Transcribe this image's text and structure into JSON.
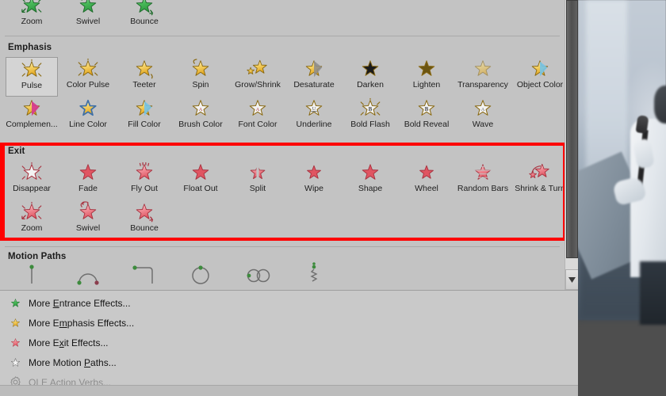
{
  "gallery": {
    "background_color": "#c3c3c3",
    "sections": [
      {
        "title": "",
        "kind": "entrance-partial",
        "color": "#3aa64a",
        "rows": [
          [
            {
              "label": "Zoom",
              "icon": "star-zoom-icon"
            },
            {
              "label": "Swivel",
              "icon": "star-swivel-icon"
            },
            {
              "label": "Bounce",
              "icon": "star-bounce-icon"
            }
          ]
        ]
      },
      {
        "title": "Emphasis",
        "kind": "emphasis",
        "color": "#e8b21f",
        "rows": [
          [
            {
              "label": "Pulse",
              "icon": "star-pulse-icon",
              "selected": true
            },
            {
              "label": "Color Pulse",
              "icon": "star-color-pulse-icon"
            },
            {
              "label": "Teeter",
              "icon": "star-teeter-icon"
            },
            {
              "label": "Spin",
              "icon": "star-spin-icon"
            },
            {
              "label": "Grow/Shrink",
              "icon": "star-grow-shrink-icon"
            },
            {
              "label": "Desaturate",
              "icon": "star-desaturate-icon"
            },
            {
              "label": "Darken",
              "icon": "star-darken-icon"
            },
            {
              "label": "Lighten",
              "icon": "star-lighten-icon"
            },
            {
              "label": "Transparency",
              "icon": "star-transparency-icon"
            },
            {
              "label": "Object Color",
              "icon": "star-object-color-icon"
            }
          ],
          [
            {
              "label": "Complemen...",
              "icon": "star-complementary-color-icon"
            },
            {
              "label": "Line Color",
              "icon": "star-line-color-icon"
            },
            {
              "label": "Fill Color",
              "icon": "star-fill-color-icon"
            },
            {
              "label": "Brush Color",
              "icon": "star-brush-color-icon"
            },
            {
              "label": "Font Color",
              "icon": "star-font-color-icon"
            },
            {
              "label": "Underline",
              "icon": "star-underline-icon"
            },
            {
              "label": "Bold Flash",
              "icon": "star-bold-flash-icon"
            },
            {
              "label": "Bold Reveal",
              "icon": "star-bold-reveal-icon"
            },
            {
              "label": "Wave",
              "icon": "star-wave-icon"
            }
          ]
        ]
      },
      {
        "title": "Exit",
        "kind": "exit",
        "color": "#e8626e",
        "highlighted": true,
        "highlight_color": "#ff0000",
        "rows": [
          [
            {
              "label": "Disappear",
              "icon": "star-disappear-icon"
            },
            {
              "label": "Fade",
              "icon": "star-fade-icon"
            },
            {
              "label": "Fly Out",
              "icon": "star-fly-out-icon"
            },
            {
              "label": "Float Out",
              "icon": "star-float-out-icon"
            },
            {
              "label": "Split",
              "icon": "star-split-icon"
            },
            {
              "label": "Wipe",
              "icon": "star-wipe-icon"
            },
            {
              "label": "Shape",
              "icon": "star-shape-icon"
            },
            {
              "label": "Wheel",
              "icon": "star-wheel-icon"
            },
            {
              "label": "Random Bars",
              "icon": "star-random-bars-icon"
            },
            {
              "label": "Shrink & Turn",
              "icon": "star-shrink-turn-icon"
            }
          ],
          [
            {
              "label": "Zoom",
              "icon": "star-zoom-icon"
            },
            {
              "label": "Swivel",
              "icon": "star-swivel-icon"
            },
            {
              "label": "Bounce",
              "icon": "star-bounce-icon"
            }
          ]
        ]
      },
      {
        "title": "Motion Paths",
        "kind": "motion-paths",
        "color": "#6f6f6f",
        "rows": [
          [
            {
              "label": "",
              "icon": "path-lines-icon"
            },
            {
              "label": "",
              "icon": "path-arcs-icon"
            },
            {
              "label": "",
              "icon": "path-turns-icon"
            },
            {
              "label": "",
              "icon": "path-shapes-icon"
            },
            {
              "label": "",
              "icon": "path-loops-icon"
            },
            {
              "label": "",
              "icon": "path-custom-icon"
            }
          ]
        ]
      }
    ]
  },
  "scrollbar": {
    "orientation": "vertical",
    "thumb_position_percent": 0,
    "down_arrow_icon": "triangle-down-icon"
  },
  "menu": {
    "items": [
      {
        "label": "More Entrance Effects...",
        "accel": "E",
        "icon": "star-green-icon",
        "disabled": false,
        "name": "more-entrance-effects"
      },
      {
        "label": "More Emphasis Effects...",
        "accel": "m",
        "icon": "star-yellow-icon",
        "disabled": false,
        "name": "more-emphasis-effects"
      },
      {
        "label": "More Exit Effects...",
        "accel": "x",
        "icon": "star-red-icon",
        "disabled": false,
        "name": "more-exit-effects"
      },
      {
        "label": "More Motion Paths...",
        "accel": "P",
        "icon": "star-outline-icon",
        "disabled": false,
        "name": "more-motion-paths"
      },
      {
        "label": "OLE Action Verbs...",
        "accel": "O",
        "icon": "gear-icon",
        "disabled": true,
        "name": "ole-action-verbs"
      }
    ]
  },
  "slide_preview": {
    "description": "blurred grayscale photo of a presenter holding a microphone and a laptop",
    "panel_color": "#545454"
  }
}
